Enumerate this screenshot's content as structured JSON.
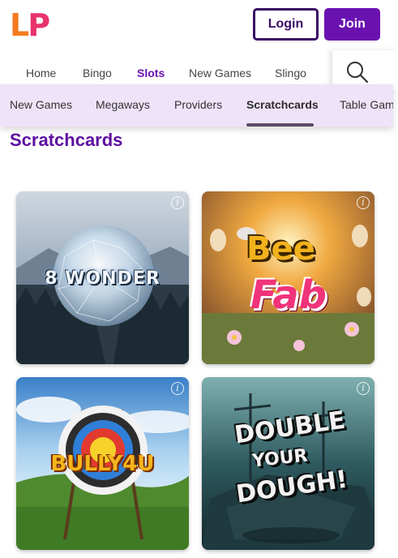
{
  "header": {
    "logo_l": "L",
    "logo_p": "P",
    "login_label": "Login",
    "join_label": "Join"
  },
  "main_nav": [
    {
      "label": "Home",
      "active": false
    },
    {
      "label": "Bingo",
      "active": false
    },
    {
      "label": "Slots",
      "active": true
    },
    {
      "label": "New Games",
      "active": false
    },
    {
      "label": "Slingo",
      "active": false
    }
  ],
  "search": {
    "icon": "search-icon"
  },
  "sub_nav": [
    {
      "label": "New Games",
      "active": false
    },
    {
      "label": "Megaways",
      "active": false
    },
    {
      "label": "Providers",
      "active": false
    },
    {
      "label": "Scratchcards",
      "active": true
    },
    {
      "label": "Table Games",
      "active": false
    }
  ],
  "page_title": "Scratchcards",
  "games": [
    {
      "title": "8 WONDER"
    },
    {
      "title_a": "Bee",
      "title_b": "Fab"
    },
    {
      "title": "BULLY4U"
    },
    {
      "title_a": "DOUBLE",
      "title_b": "YOUR",
      "title_c": "DOUGH!"
    }
  ],
  "info_glyph": "i",
  "colors": {
    "brand_purple": "#6a12b0",
    "title_purple": "#5c0fa0",
    "subnav_bg": "#efe3f9",
    "logo_orange": "#f47a1f",
    "logo_pink": "#e8336d"
  }
}
